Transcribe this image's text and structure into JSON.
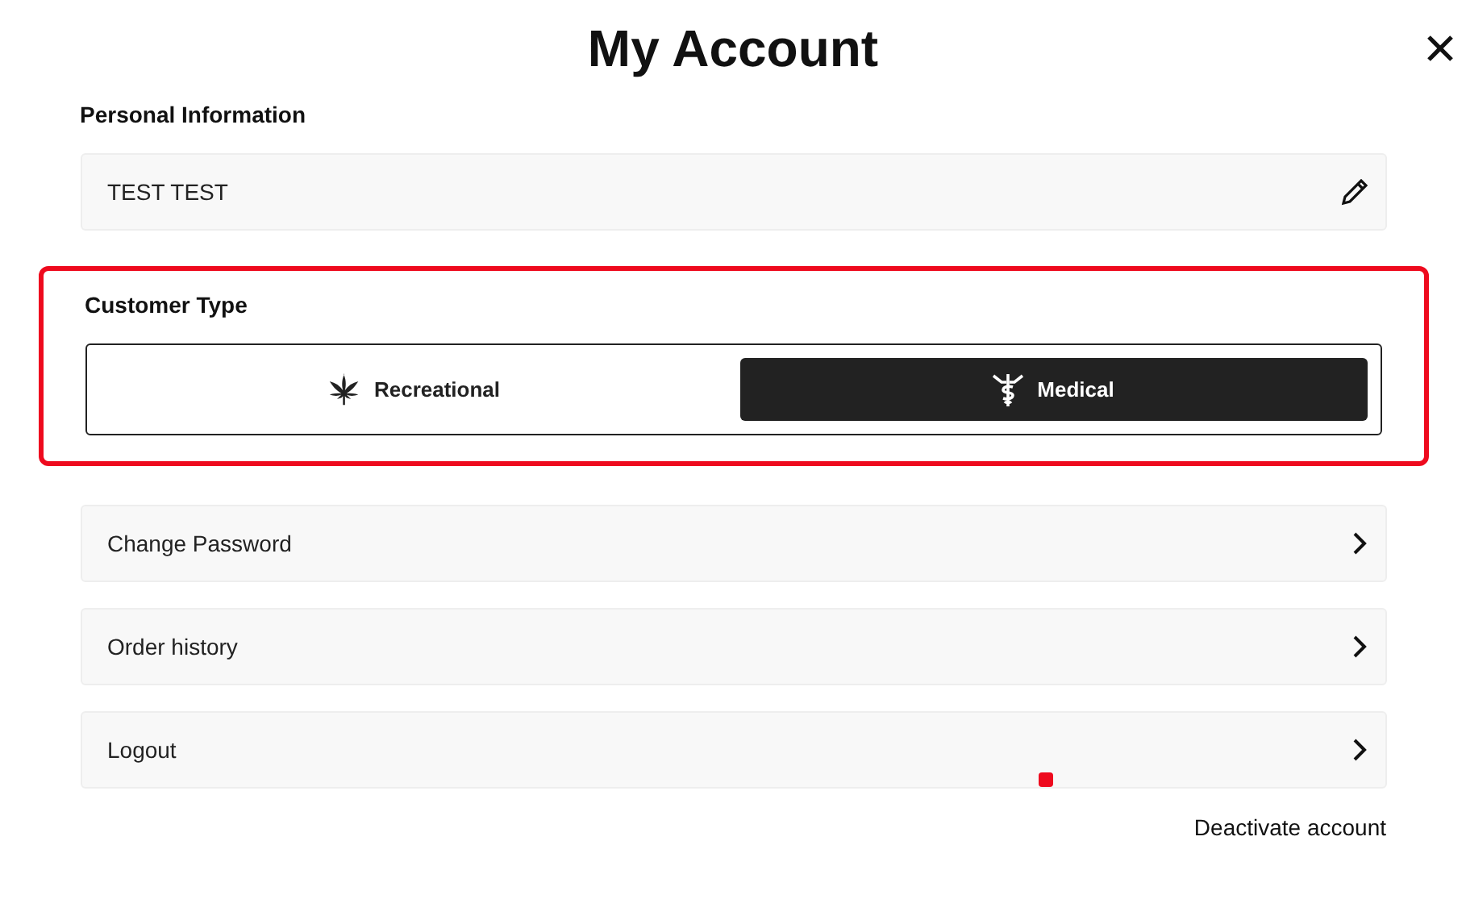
{
  "title": "My Account",
  "personal": {
    "heading": "Personal Information",
    "name": "TEST TEST"
  },
  "customer_type": {
    "heading": "Customer Type",
    "highlighted": true,
    "options": [
      {
        "label": "Recreational",
        "selected": false
      },
      {
        "label": "Medical",
        "selected": true
      }
    ]
  },
  "menu": [
    {
      "label": "Change Password"
    },
    {
      "label": "Order history"
    },
    {
      "label": "Logout"
    }
  ],
  "deactivate": "Deactivate account"
}
